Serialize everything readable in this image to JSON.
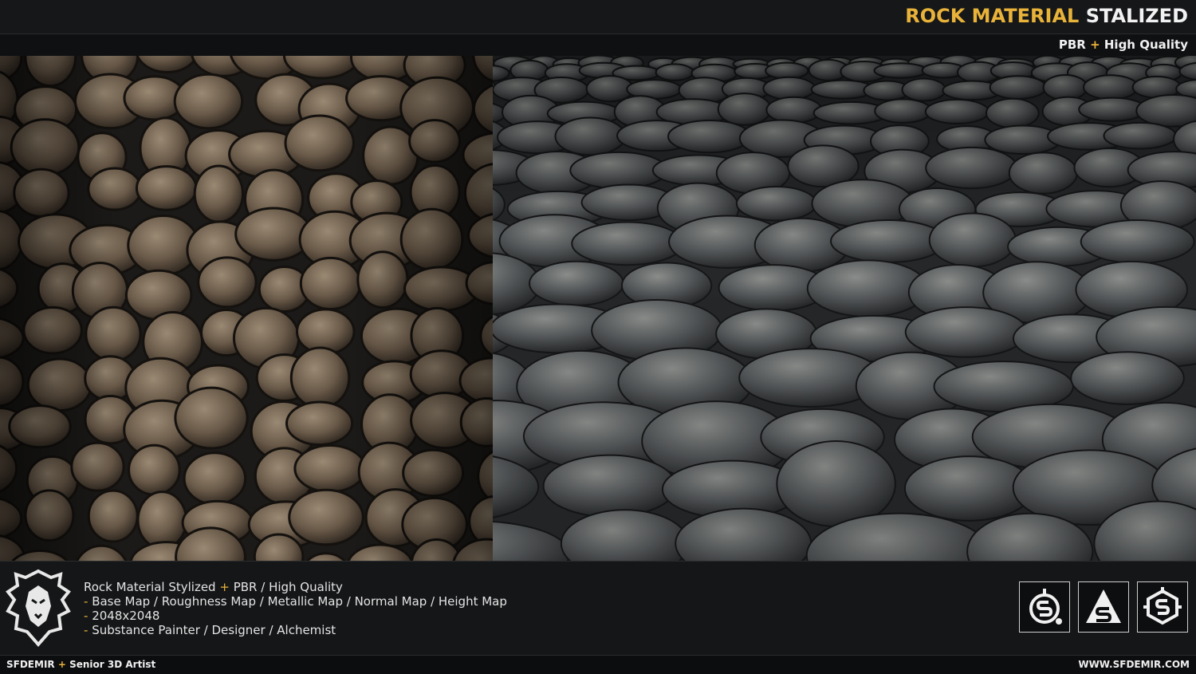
{
  "header": {
    "title_primary": "ROCK MATERIAL",
    "title_secondary": "STALIZED",
    "subtitle_left": "PBR",
    "subtitle_plus": "+",
    "subtitle_right": "High Quality"
  },
  "info": {
    "line1_a": "Rock Material Stylized",
    "line1_plus": "+",
    "line1_b": "PBR / High Quality",
    "dash": "-",
    "line2": "Base Map / Roughness Map / Metallic Map / Normal Map / Height Map",
    "line3": "2048x2048",
    "line4": "Substance Painter / Designer / Alchemist"
  },
  "icons": [
    "substance-painter-icon",
    "substance-designer-icon",
    "substance-alchemist-icon"
  ],
  "footer": {
    "left_name": "SFDEMIR",
    "left_plus": "+",
    "left_role": "Senior 3D Artist",
    "right": "WWW.SFDEMIR.COM"
  },
  "colors": {
    "accent": "#e9b33a",
    "background": "#111214"
  }
}
